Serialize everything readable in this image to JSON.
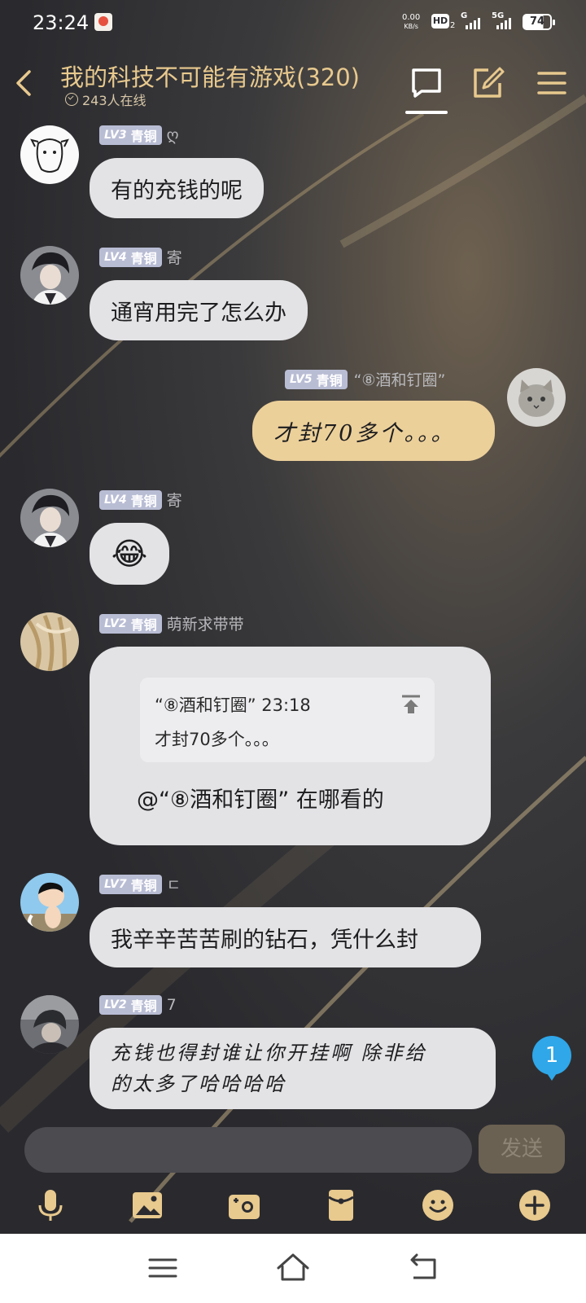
{
  "status_bar": {
    "time": "23:24",
    "net_speed_value": "0.00",
    "net_speed_unit": "KB/s",
    "hd_label": "HD",
    "hd_sub": "2",
    "sig1_label": "G",
    "sig2_label": "5G",
    "battery": "74"
  },
  "header": {
    "title": "我的科技不可能有游戏(320)",
    "online": "243人在线"
  },
  "messages": [
    {
      "level": "LV3",
      "tier": "青铜",
      "nick": "ღ",
      "text": "有的充钱的呢"
    },
    {
      "level": "LV4",
      "tier": "青铜",
      "nick": "寄",
      "text": "通宵用完了怎么办"
    },
    {
      "level": "LV5",
      "tier": "青铜",
      "nick": "“⑧酒和钉圈”",
      "text": "才封70多个。。。"
    },
    {
      "level": "LV4",
      "tier": "青铜",
      "nick": "寄",
      "text": "😂"
    },
    {
      "level": "LV2",
      "tier": "青铜",
      "nick": "萌新求带带",
      "quote_header": "“⑧酒和钉圈” 23:18",
      "quote_text": "才封70多个。。。",
      "text": "@“⑧酒和钉圈” 在哪看的"
    },
    {
      "level": "LV7",
      "tier": "青铜",
      "nick": "ㄷ",
      "text": "我辛辛苦苦刷的钻石，凭什么封"
    },
    {
      "level": "LV2",
      "tier": "青铜",
      "nick": "7",
      "text_line1": "充钱也得封谁让你开挂啊 除非给",
      "text_line2": "的太多了哈哈哈哈"
    }
  ],
  "unread_count": "1",
  "composer": {
    "placeholder": "",
    "send_label": "发送"
  },
  "colors": {
    "accent_gold": "#e8c98e",
    "my_bubble": "#ecd09a",
    "other_bubble": "#e3e3e6",
    "level_badge": "#b9bdd4",
    "unread_badge": "#2fa7e8"
  },
  "icons": {
    "header": [
      "back-icon",
      "chat-icon",
      "edit-icon",
      "menu-icon"
    ],
    "toolbar": [
      "microphone-icon",
      "image-icon",
      "camera-icon",
      "red-packet-icon",
      "emoji-icon",
      "plus-icon"
    ],
    "nav": [
      "recent-apps-icon",
      "home-icon",
      "back-nav-icon"
    ]
  }
}
